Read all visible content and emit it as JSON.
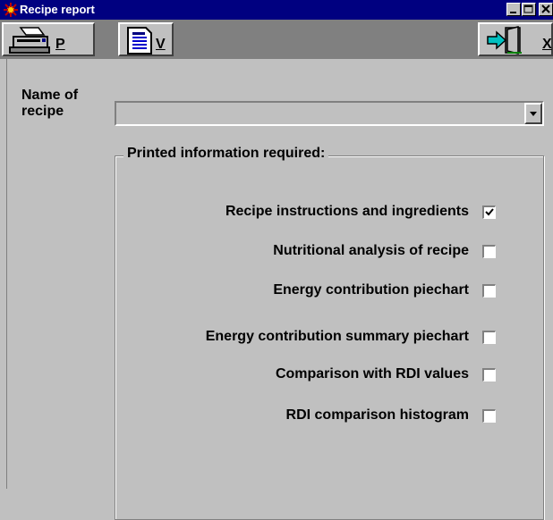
{
  "window": {
    "title": "Recipe report"
  },
  "toolbar": {
    "print_hotkey": "P",
    "view_hotkey": "V",
    "exit_hotkey": "X"
  },
  "form": {
    "name_label_line1": "Name of",
    "name_label_line2": "recipe",
    "recipe_value": "",
    "group_title": "Printed information required:",
    "options": [
      {
        "label": "Recipe instructions and ingredients",
        "checked": true
      },
      {
        "label": "Nutritional analysis of recipe",
        "checked": false
      },
      {
        "label": "Energy contribution piechart",
        "checked": false
      },
      {
        "label": "Energy contribution summary piechart",
        "checked": false
      },
      {
        "label": "Comparison with RDI values",
        "checked": false
      },
      {
        "label": "RDI comparison histogram",
        "checked": false
      }
    ]
  },
  "colors": {
    "titlebar": "#000080",
    "face": "#c0c0c0",
    "toolbar_bg": "#808080"
  }
}
